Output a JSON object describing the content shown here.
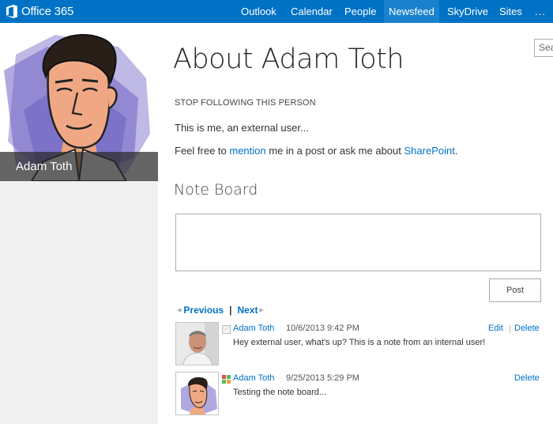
{
  "suitebar": {
    "brand": "Office 365",
    "nav": [
      {
        "label": "Outlook"
      },
      {
        "label": "Calendar"
      },
      {
        "label": "People"
      },
      {
        "label": "Newsfeed"
      },
      {
        "label": "SkyDrive"
      },
      {
        "label": "Sites"
      }
    ],
    "active_nav": "Newsfeed",
    "more": "..."
  },
  "profile": {
    "name": "Adam Toth"
  },
  "search": {
    "placeholder": "Sea"
  },
  "main": {
    "title": "About Adam Toth",
    "follow_link": "STOP FOLLOWING THIS PERSON",
    "about_line1": "This is me, an external user...",
    "about_line2": {
      "prefix": "Feel free to ",
      "mention_link": "mention",
      "middle": " me in a post or ask me about ",
      "sharepoint_link": "SharePoint",
      "suffix": "."
    },
    "note_board_title": "Note Board",
    "post_label": "Post",
    "pager": {
      "previous": "Previous",
      "separator": "|",
      "next": "Next"
    },
    "notes": [
      {
        "author": "Adam Toth",
        "time": "10/6/2013 9:42 PM",
        "text": "Hey external user, what's up? This is a note from an internal user!",
        "edit": "Edit",
        "delete": "Delete"
      },
      {
        "author": "Adam Toth",
        "time": "9/25/2013 5:29 PM",
        "text": "Testing the note board...",
        "delete": "Delete"
      }
    ]
  },
  "colors": {
    "suitebar": "#0072c6",
    "link": "#0072c6",
    "sidebar": "#f0f0f0"
  }
}
